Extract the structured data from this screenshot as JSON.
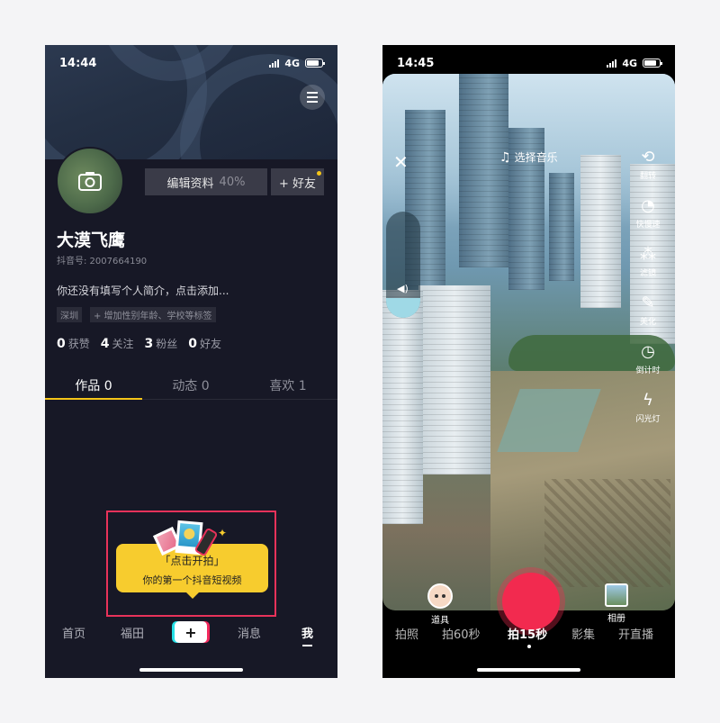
{
  "left_screen": {
    "status": {
      "time": "14:44",
      "network": "4G"
    },
    "profile": {
      "edit_label": "编辑资料",
      "edit_progress": "40%",
      "add_friend_label": "+ 好友",
      "name": "大漠飞鹰",
      "douyin_id": "抖音号: 2007664190",
      "bio": "你还没有填写个人简介，点击添加...",
      "tags": [
        "深圳",
        "+ 增加性别年龄、学校等标签"
      ],
      "stats": [
        {
          "value": "0",
          "label": "获赞"
        },
        {
          "value": "4",
          "label": "关注"
        },
        {
          "value": "3",
          "label": "粉丝"
        },
        {
          "value": "0",
          "label": "好友"
        }
      ]
    },
    "tabs": [
      "作品 0",
      "动态 0",
      "喜欢 1"
    ],
    "tooltip": {
      "line1": "「点击开拍」",
      "line2": "你的第一个抖音短视频"
    },
    "bottom_nav": {
      "home": "首页",
      "local": "福田",
      "plus": "+",
      "messages": "消息",
      "me": "我"
    }
  },
  "right_screen": {
    "status": {
      "time": "14:45",
      "network": "4G"
    },
    "music_label": "选择音乐",
    "tools": [
      {
        "icon": "flip-camera-icon",
        "label": "翻转"
      },
      {
        "icon": "speed-icon",
        "label": "快慢速"
      },
      {
        "icon": "filter-icon",
        "label": "滤镜"
      },
      {
        "icon": "beauty-icon",
        "label": "美化"
      },
      {
        "icon": "countdown-icon",
        "label": "倒计时"
      },
      {
        "icon": "flash-icon",
        "label": "闪光灯"
      }
    ],
    "props_label": "道具",
    "album_label": "相册",
    "modes": [
      "拍照",
      "拍60秒",
      "拍15秒",
      "影集",
      "开直播"
    ],
    "active_mode": "拍15秒"
  },
  "colors": {
    "accent_yellow": "#f5c518",
    "highlight_red": "#e8325a",
    "record_red": "#f22a4f"
  }
}
